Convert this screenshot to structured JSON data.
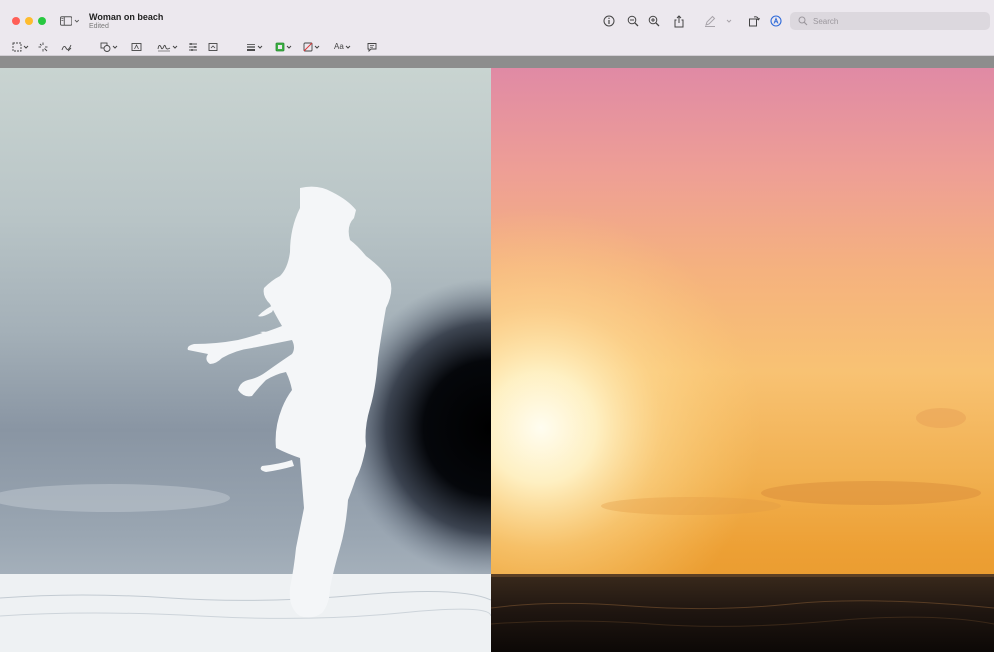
{
  "window": {
    "title": "Woman on beach",
    "subtitle": "Edited"
  },
  "toolbar": {
    "search_placeholder": "Search",
    "icons": [
      "sidebar-toggle-icon",
      "info-icon",
      "zoom-out-icon",
      "zoom-in-icon",
      "share-icon",
      "highlight-pen-icon",
      "rotate-icon",
      "markup-icon",
      "search-icon"
    ]
  },
  "markup_toolbar": {
    "tools": [
      "rect-select-icon",
      "instant-alpha-icon",
      "sketch-icon",
      "shapes-icon",
      "text-box-icon",
      "signature-icon",
      "adjust-color-icon",
      "adjust-size-icon",
      "border-style-icon",
      "border-color-icon",
      "fill-color-icon",
      "text-style-icon",
      "note-icon"
    ],
    "text_style_label": "Aa"
  },
  "colors": {
    "close": "#ff5f57",
    "minimize": "#febc2e",
    "maximize": "#28c840",
    "border_color_swatch": "#3cb043",
    "markup_accent": "#2f6ad9"
  }
}
